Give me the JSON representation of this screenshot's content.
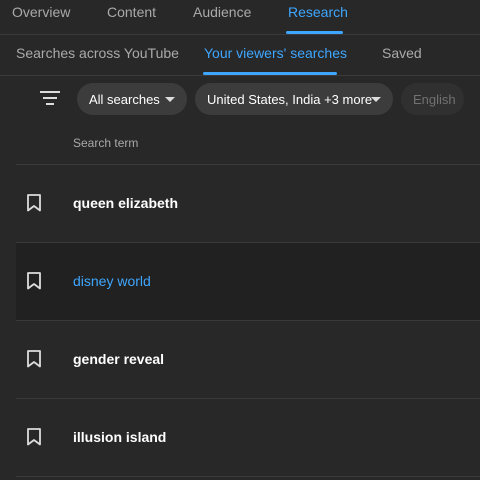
{
  "top_tabs": [
    "Overview",
    "Content",
    "Audience",
    "Research"
  ],
  "sub_tabs": [
    "Searches across YouTube",
    "Your viewers' searches",
    "Saved"
  ],
  "filters": {
    "icon": "filter-icon",
    "chips": [
      "All searches",
      "United States, India +3 more",
      "English"
    ]
  },
  "table": {
    "header": "Search term",
    "rows": [
      "queen elizabeth",
      "disney world",
      "gender reveal",
      "illusion island"
    ]
  },
  "colors": {
    "accent": "#3ea6ff",
    "background": "#282828",
    "highlight_row": "#212121"
  }
}
